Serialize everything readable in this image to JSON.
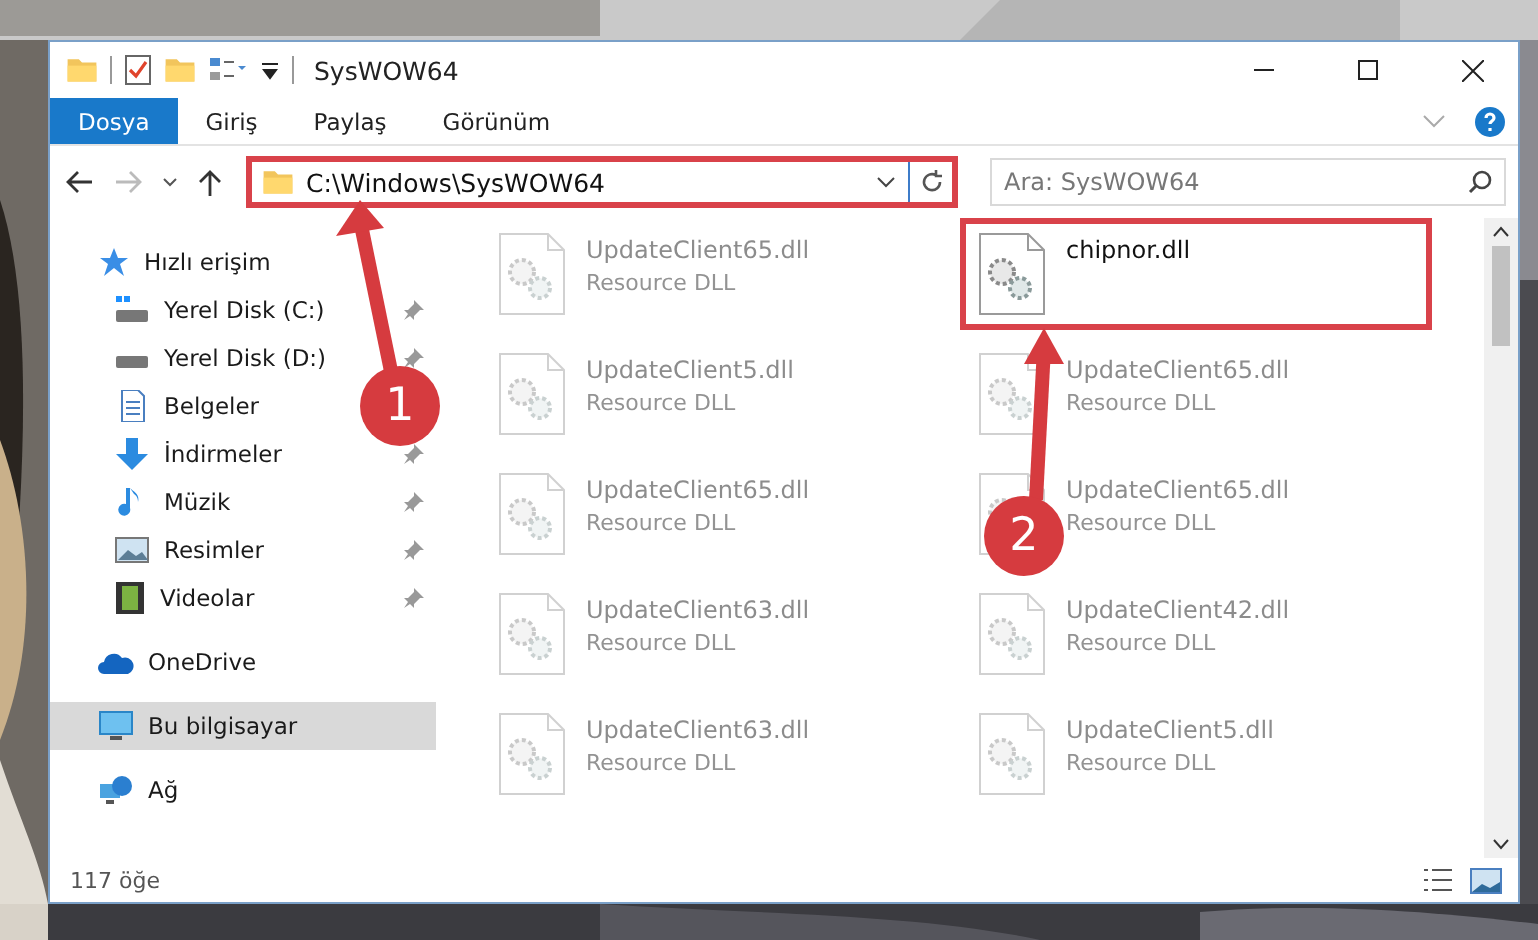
{
  "window": {
    "title": "SysWOW64"
  },
  "ribbon_tabs": [
    {
      "label": "Dosya",
      "selected": true
    },
    {
      "label": "Giriş",
      "selected": false
    },
    {
      "label": "Paylaş",
      "selected": false
    },
    {
      "label": "Görünüm",
      "selected": false
    }
  ],
  "address_bar": {
    "path": "C:\\Windows\\SysWOW64",
    "highlighted": true
  },
  "search": {
    "placeholder": "Ara: SysWOW64"
  },
  "sidebar": {
    "items": [
      {
        "label": "Hızlı erişim",
        "selected": false,
        "children": [
          {
            "label": "Yerel Disk (C:)",
            "pinned": true
          },
          {
            "label": "Yerel Disk (D:)",
            "pinned": true
          },
          {
            "label": "Belgeler"
          },
          {
            "label": "İndirmeler",
            "pinned": true
          },
          {
            "label": "Müzik",
            "pinned": true
          },
          {
            "label": "Resimler",
            "pinned": true
          },
          {
            "label": "Videolar",
            "pinned": true
          }
        ]
      },
      {
        "label": "OneDrive",
        "selected": false
      },
      {
        "label": "Bu bilgisayar",
        "selected": true
      },
      {
        "label": "Ağ",
        "selected": false
      }
    ]
  },
  "files": [
    {
      "name": "UpdateClient65.dll",
      "type": "Resource DLL",
      "blurred": true,
      "highlighted": false
    },
    {
      "name": "chipnor.dll",
      "blurred": false,
      "highlighted": true
    },
    {
      "name": "UpdateClient5.dll",
      "type": "Resource DLL",
      "blurred": true,
      "highlighted": false
    },
    {
      "name": "UpdateClient65.dll",
      "type": "Resource DLL",
      "blurred": true,
      "highlighted": false
    },
    {
      "name": "UpdateClient65.dll",
      "type": "Resource DLL",
      "blurred": true,
      "highlighted": false
    },
    {
      "name": "UpdateClient65.dll",
      "type": "Resource DLL",
      "blurred": true,
      "highlighted": false
    },
    {
      "name": "UpdateClient63.dll",
      "type": "Resource DLL",
      "blurred": true,
      "highlighted": false
    },
    {
      "name": "UpdateClient42.dll",
      "type": "Resource DLL",
      "blurred": true,
      "highlighted": false
    },
    {
      "name": "UpdateClient63.dll",
      "type": "Resource DLL",
      "blurred": true,
      "highlighted": false
    },
    {
      "name": "UpdateClient5.dll",
      "type": "Resource DLL",
      "blurred": true,
      "highlighted": false
    }
  ],
  "status_bar": {
    "item_count": "117 öğe"
  },
  "annotations": [
    {
      "label": "1"
    },
    {
      "label": "2"
    }
  ]
}
